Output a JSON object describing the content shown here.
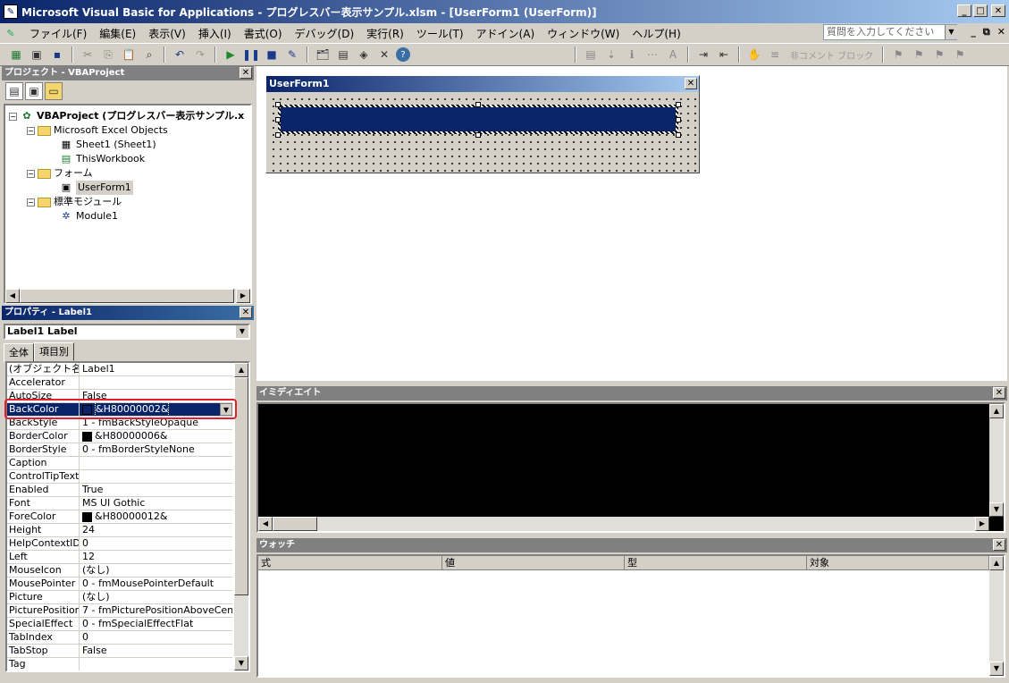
{
  "window": {
    "title": "Microsoft Visual Basic for Applications - プログレスバー表示サンプル.xlsm - [UserForm1 (UserForm)]"
  },
  "menu": {
    "items": [
      "ファイル(F)",
      "編集(E)",
      "表示(V)",
      "挿入(I)",
      "書式(O)",
      "デバッグ(D)",
      "実行(R)",
      "ツール(T)",
      "アドイン(A)",
      "ウィンドウ(W)",
      "ヘルプ(H)"
    ],
    "help_placeholder": "質問を入力してください"
  },
  "toolbar": {
    "uncomment_label": "非コメント ブロック"
  },
  "project": {
    "title": "プロジェクト - VBAProject",
    "root": "VBAProject (プログレスバー表示サンプル.x",
    "excel_objects": "Microsoft Excel Objects",
    "sheet1": "Sheet1 (Sheet1)",
    "thisworkbook": "ThisWorkbook",
    "forms": "フォーム",
    "userform1": "UserForm1",
    "modules": "標準モジュール",
    "module1": "Module1"
  },
  "properties": {
    "title": "プロパティ - Label1",
    "object_combo": "Label1 Label",
    "tabs": [
      "全体",
      "項目別"
    ],
    "rows": [
      {
        "k": "(オブジェクト名)",
        "v": "Label1"
      },
      {
        "k": "Accelerator",
        "v": ""
      },
      {
        "k": "AutoSize",
        "v": "False"
      },
      {
        "k": "BackColor",
        "v": "&H80000002&"
      },
      {
        "k": "BackStyle",
        "v": "1 - fmBackStyleOpaque"
      },
      {
        "k": "BorderColor",
        "v": "&H80000006&"
      },
      {
        "k": "BorderStyle",
        "v": "0 - fmBorderStyleNone"
      },
      {
        "k": "Caption",
        "v": ""
      },
      {
        "k": "ControlTipText",
        "v": ""
      },
      {
        "k": "Enabled",
        "v": "True"
      },
      {
        "k": "Font",
        "v": "MS UI Gothic"
      },
      {
        "k": "ForeColor",
        "v": "&H80000012&"
      },
      {
        "k": "Height",
        "v": "24"
      },
      {
        "k": "HelpContextID",
        "v": "0"
      },
      {
        "k": "Left",
        "v": "12"
      },
      {
        "k": "MouseIcon",
        "v": "(なし)"
      },
      {
        "k": "MousePointer",
        "v": "0 - fmMousePointerDefault"
      },
      {
        "k": "Picture",
        "v": "(なし)"
      },
      {
        "k": "PicturePosition",
        "v": "7 - fmPicturePositionAboveCent"
      },
      {
        "k": "SpecialEffect",
        "v": "0 - fmSpecialEffectFlat"
      },
      {
        "k": "TabIndex",
        "v": "0"
      },
      {
        "k": "TabStop",
        "v": "False"
      },
      {
        "k": "Tag",
        "v": ""
      }
    ]
  },
  "userform": {
    "title": "UserForm1",
    "label_color": "#0a246a"
  },
  "immediate": {
    "title": "イミディエイト"
  },
  "watch": {
    "title": "ウォッチ",
    "columns": [
      "式",
      "値",
      "型",
      "対象"
    ]
  },
  "colors": {
    "title_active": "#0a246a",
    "highlight": "#e0202c"
  }
}
